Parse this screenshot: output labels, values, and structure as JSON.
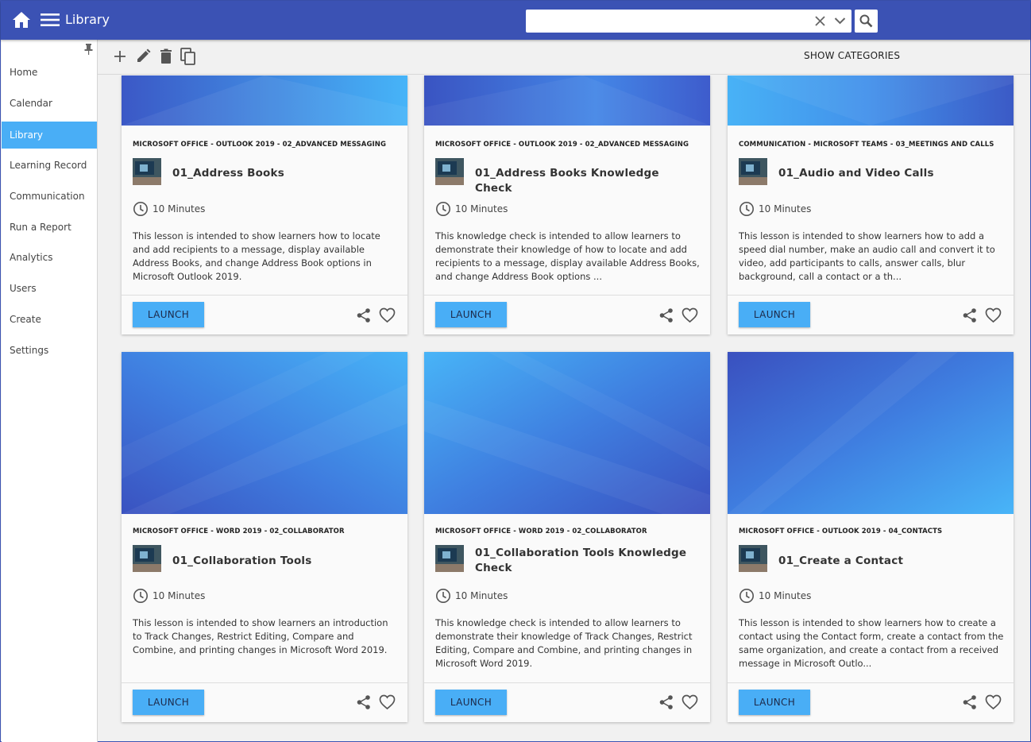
{
  "header": {
    "title": "Library",
    "search": {
      "value": "",
      "placeholder": ""
    }
  },
  "sidebar": {
    "items": [
      {
        "label": "Home"
      },
      {
        "label": "Calendar"
      },
      {
        "label": "Library",
        "active": true
      },
      {
        "label": "Learning Record"
      },
      {
        "label": "Communication"
      },
      {
        "label": "Run a Report"
      },
      {
        "label": "Analytics"
      },
      {
        "label": "Users"
      },
      {
        "label": "Create"
      },
      {
        "label": "Settings"
      }
    ]
  },
  "toolbar": {
    "icons": [
      "add-icon",
      "edit-icon",
      "delete-icon",
      "copy-icon"
    ],
    "show_categories_label": "SHOW CATEGORIES"
  },
  "colors": {
    "header": "#3b52b4",
    "accent": "#49aef6",
    "background": "#f1f1f1"
  },
  "cards": [
    {
      "category": "MICROSOFT OFFICE - OUTLOOK 2019 - 02_ADVANCED MESSAGING",
      "title": "01_Address Books",
      "duration": "10 Minutes",
      "description": "This lesson is intended to show learners how to locate and add recipients to a message, display available Address Books, and change Address Book options in Microsoft Outlook 2019.",
      "launch_label": "LAUNCH"
    },
    {
      "category": "MICROSOFT OFFICE - OUTLOOK 2019 - 02_ADVANCED MESSAGING",
      "title": "01_Address Books Knowledge Check",
      "duration": "10 Minutes",
      "description": "This knowledge check is intended to allow learners to demonstrate their knowledge of how to locate and add recipients to a message, display available Address Books, and change Address Book options ...",
      "launch_label": "LAUNCH"
    },
    {
      "category": "COMMUNICATION - MICROSOFT TEAMS - 03_MEETINGS AND CALLS",
      "title": "01_Audio and Video Calls",
      "duration": "10 Minutes",
      "description": "This lesson is intended to show learners how to add a speed dial number, make an audio call and convert it to video, add participants to calls, answer calls, blur background, call a contact or a th...",
      "launch_label": "LAUNCH"
    },
    {
      "category": "MICROSOFT OFFICE - WORD 2019 - 02_COLLABORATOR",
      "title": "01_Collaboration Tools",
      "duration": "10 Minutes",
      "description": "This lesson is intended to show learners an introduction to Track Changes, Restrict Editing, Compare and Combine, and printing changes in Microsoft Word 2019.",
      "launch_label": "LAUNCH"
    },
    {
      "category": "MICROSOFT OFFICE - WORD 2019 - 02_COLLABORATOR",
      "title": "01_Collaboration Tools Knowledge Check",
      "duration": "10 Minutes",
      "description": "This knowledge check is intended to allow learners to demonstrate their knowledge of Track Changes, Restrict Editing, Compare and Combine, and printing changes in Microsoft Word 2019.",
      "launch_label": "LAUNCH"
    },
    {
      "category": "MICROSOFT OFFICE - OUTLOOK 2019 - 04_CONTACTS",
      "title": "01_Create a Contact",
      "duration": "10 Minutes",
      "description": "This lesson is intended to show learners how to create a contact using the Contact form, create a contact from the same organization, and create a contact from a received message in Microsoft Outlo...",
      "launch_label": "LAUNCH"
    }
  ]
}
